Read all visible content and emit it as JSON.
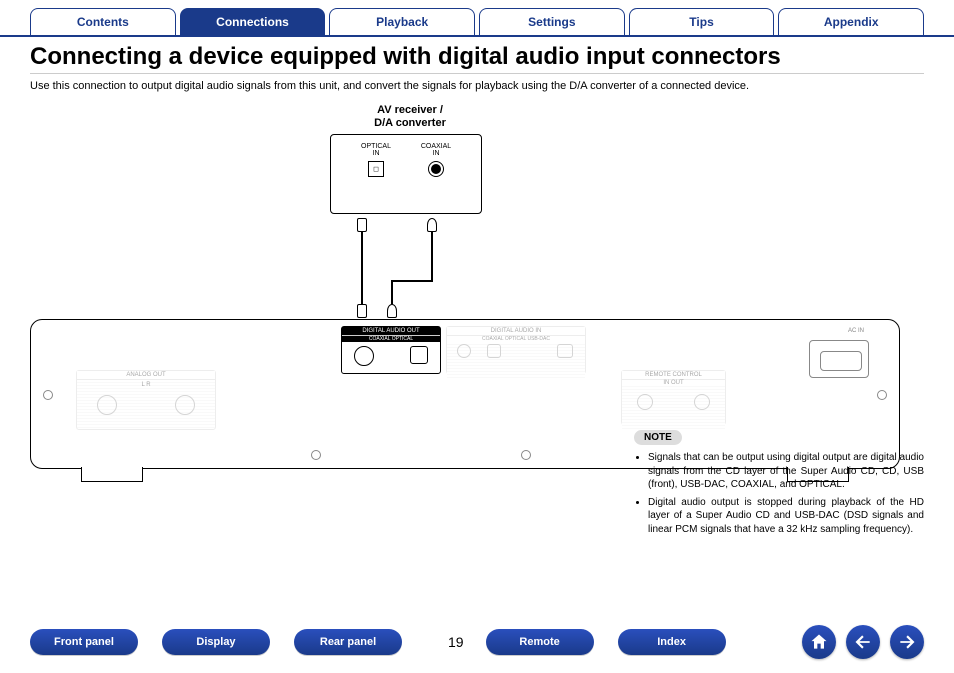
{
  "top_tabs": [
    "Contents",
    "Connections",
    "Playback",
    "Settings",
    "Tips",
    "Appendix"
  ],
  "active_tab_index": 1,
  "page_title": "Connecting a device equipped with digital audio input connectors",
  "subtitle": "Use this connection to output digital audio signals from this unit, and convert the signals for playback using the D/A converter of a connected device.",
  "receiver_label_line1": "AV receiver /",
  "receiver_label_line2": "D/A converter",
  "receiver_ports": {
    "left_label1": "OPTICAL",
    "left_label2": "IN",
    "right_label1": "COAXIAL",
    "right_label2": "IN"
  },
  "device": {
    "acin_label": "AC IN",
    "digital_out_label": "DIGITAL AUDIO OUT",
    "digital_out_sub": "COAXIAL  OPTICAL",
    "digital_in_label": "DIGITAL AUDIO IN",
    "digital_in_sub": "COAXIAL  OPTICAL  USB-DAC",
    "analog_out_label": "ANALOG OUT",
    "analog_out_lr": "L                    R",
    "remote_label": "REMOTE CONTROL",
    "remote_sub": "IN          OUT"
  },
  "note": {
    "badge": "NOTE",
    "items": [
      "Signals that can be output using digital output are digital audio signals from the CD layer of the Super Audio CD, CD, USB (front), USB-DAC, COAXIAL, and OPTICAL.",
      "Digital audio output is stopped during playback of the HD layer of a Super Audio CD and USB-DAC (DSD signals and linear PCM signals that have a 32 kHz sampling frequency)."
    ]
  },
  "bottom_nav": [
    "Front panel",
    "Display",
    "Rear panel",
    "Remote",
    "Index"
  ],
  "page_number": "19",
  "nav_icons": [
    "home-icon",
    "prev-icon",
    "next-icon"
  ]
}
